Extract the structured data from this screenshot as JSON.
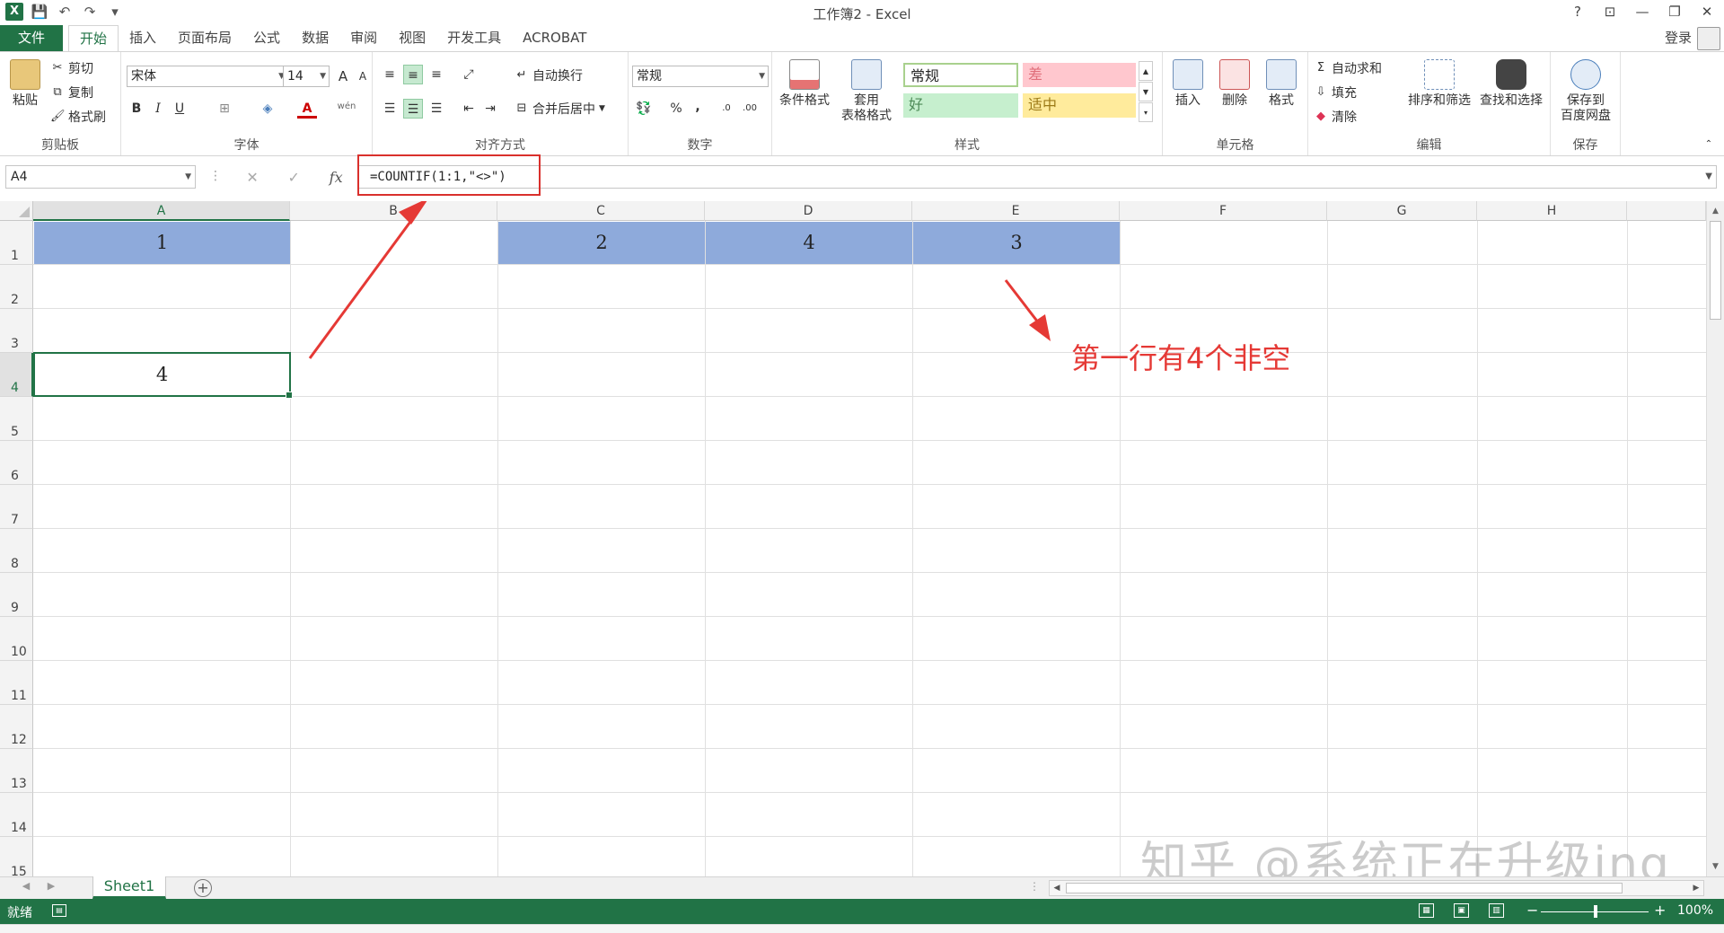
{
  "window": {
    "title": "工作簿2 - Excel"
  },
  "qat": {
    "logo": "X",
    "save_icon": "save-icon",
    "undo_icon": "undo-icon",
    "redo_icon": "redo-icon",
    "customize_icon": "customize-icon"
  },
  "win_controls": {
    "help": "?",
    "ribbon_opts": "⊡",
    "minimize": "—",
    "restore": "❐",
    "close": "✕"
  },
  "tabs": {
    "file": "文件",
    "items": [
      "开始",
      "插入",
      "页面布局",
      "公式",
      "数据",
      "审阅",
      "视图",
      "开发工具",
      "ACROBAT"
    ],
    "login": "登录"
  },
  "ribbon": {
    "clipboard": {
      "label": "剪贴板",
      "paste": "粘贴",
      "cut": "剪切",
      "copy": "复制",
      "format_painter": "格式刷"
    },
    "font": {
      "label": "字体",
      "font_name": "宋体",
      "font_size": "14",
      "grow": "A",
      "shrink": "A",
      "bold": "B",
      "italic": "I",
      "underline": "U",
      "font_color": "A",
      "phonetic": "wén"
    },
    "alignment": {
      "label": "对齐方式",
      "wrap": "自动换行",
      "merge": "合并后居中"
    },
    "number": {
      "label": "数字",
      "format": "常规",
      "percent": "%",
      "comma": ","
    },
    "styles": {
      "label": "样式",
      "cond_format": "条件格式",
      "table_format_1": "套用",
      "table_format_2": "表格格式",
      "normal": "常规",
      "bad": "差",
      "good": "好",
      "neutral": "适中"
    },
    "cells": {
      "label": "单元格",
      "insert": "插入",
      "delete": "删除",
      "format": "格式"
    },
    "editing": {
      "label": "编辑",
      "autosum": "自动求和",
      "fill": "填充",
      "clear": "清除",
      "sort": "排序和筛选",
      "find": "查找和选择"
    },
    "save": {
      "label": "保存",
      "save_to_1": "保存到",
      "save_to_2": "百度网盘"
    }
  },
  "formula_bar": {
    "name_box": "A4",
    "cancel": "✕",
    "enter": "✓",
    "fx": "fx",
    "formula": "=COUNTIF(1:1,\"<>\")"
  },
  "grid": {
    "columns": [
      "A",
      "B",
      "C",
      "D",
      "E",
      "F",
      "G",
      "H"
    ],
    "rows": [
      "1",
      "2",
      "3",
      "4",
      "5",
      "6",
      "7",
      "8",
      "9",
      "10",
      "11",
      "12",
      "13",
      "14",
      "15"
    ],
    "cells": {
      "A1": "1",
      "C1": "2",
      "D1": "4",
      "E1": "3",
      "A4": "4"
    },
    "fill_color": "#8eaadb",
    "active_cell": "A4"
  },
  "annotation": {
    "text": "第一行有4个非空",
    "color": "#e53935"
  },
  "watermark": "知乎 @系统正在升级ing",
  "sheets": {
    "tabs": [
      "Sheet1"
    ],
    "add": "+"
  },
  "status": {
    "ready": "就绪",
    "zoom": "100%",
    "zoom_minus": "−",
    "zoom_plus": "+"
  },
  "colors": {
    "accent": "#217346",
    "highlight": "#d9302c"
  }
}
